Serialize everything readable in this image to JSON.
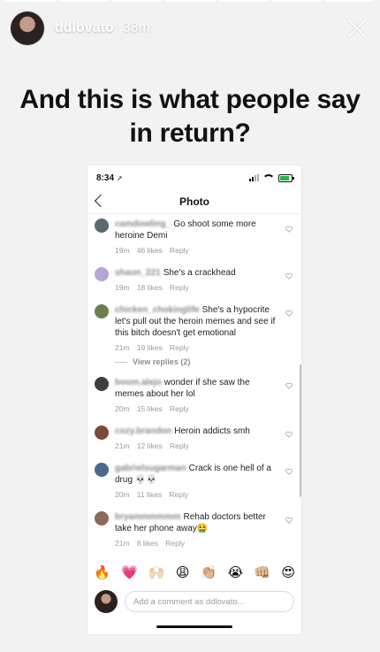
{
  "story": {
    "username": "ddlovato",
    "time": "38m",
    "caption": "And this is what people say in return?"
  },
  "screenshot": {
    "status_time": "8:34",
    "nav_title": "Photo",
    "comments": [
      {
        "username": "camdowling_",
        "text": "Go shoot some more heroine Demi",
        "time": "19m",
        "likes": "46 likes",
        "reply": "Reply",
        "avatar_color": "#5a6a72"
      },
      {
        "username": "shaun_221",
        "text": "She's a crackhead",
        "time": "19m",
        "likes": "18 likes",
        "reply": "Reply",
        "avatar_color": "#b7a3d8"
      },
      {
        "username": "chicken_chokinglife",
        "text": "She's a hypocrite let's pull out the heroin memes and see if this bitch doesn't get emotional",
        "time": "21m",
        "likes": "19 likes",
        "reply": "Reply",
        "avatar_color": "#6d7f4f"
      },
      {
        "username": "boom.alejo",
        "text": "wonder if she saw the memes about her lol",
        "time": "20m",
        "likes": "15 likes",
        "reply": "Reply",
        "avatar_color": "#3e3e3e"
      },
      {
        "username": "cozy.brandon",
        "text": "Heroin addicts smh",
        "time": "21m",
        "likes": "12 likes",
        "reply": "Reply",
        "avatar_color": "#7a4b3a"
      },
      {
        "username": "gabrielsugarman",
        "text": "Crack is one hell of a drug 💀💀",
        "time": "20m",
        "likes": "11 likes",
        "reply": "Reply",
        "avatar_color": "#4a6a8a"
      },
      {
        "username": "bryammmmmm",
        "text": "Rehab doctors better take her phone away🤮",
        "time": "21m",
        "likes": "8 likes",
        "reply": "Reply",
        "avatar_color": "#8a6a5a"
      }
    ],
    "view_replies": "View replies (2)",
    "emojis": [
      "🔥",
      "💗",
      "🙌🏻",
      "😩",
      "👏🏼",
      "😭",
      "👊🏼",
      "😍"
    ],
    "comment_placeholder": "Add a comment as ddlovato..."
  },
  "icons": {
    "close": "close-icon",
    "back": "chevron-left-icon",
    "heart": "heart-icon",
    "wifi": "wifi-icon",
    "battery": "battery-icon",
    "signal": "signal-icon",
    "location": "location-arrow-icon"
  }
}
